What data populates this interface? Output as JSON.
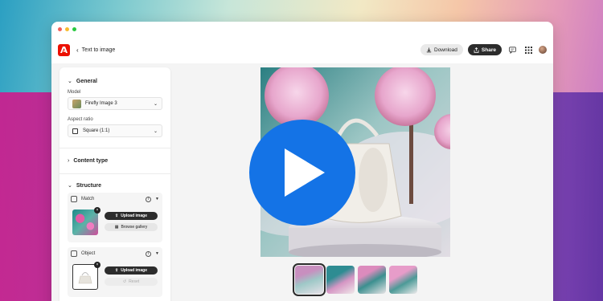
{
  "header": {
    "back_label": "Text to image",
    "download_label": "Download",
    "share_label": "Share"
  },
  "panel": {
    "general": {
      "title": "General",
      "model_label": "Model",
      "model_value": "Firefly Image 3",
      "aspect_label": "Aspect ratio",
      "aspect_value": "Square (1:1)"
    },
    "content_type": {
      "title": "Content type"
    },
    "structure": {
      "title": "Structure",
      "match": {
        "label": "Match",
        "upload": "Upload image",
        "browse": "Browse gallery"
      },
      "object": {
        "label": "Object",
        "upload": "Upload image",
        "reset": "Reset"
      }
    }
  },
  "icons": [
    "adobe-logo",
    "chevron-left-icon",
    "download-icon",
    "share-icon",
    "comment-icon",
    "apps-grid-icon",
    "avatar",
    "play-icon"
  ],
  "colors": {
    "accent": "#1473e6",
    "brand": "#eb1000",
    "dark_button": "#2c2c2c"
  },
  "gallery": {
    "thumbnail_count": 4,
    "selected_index": 0
  }
}
